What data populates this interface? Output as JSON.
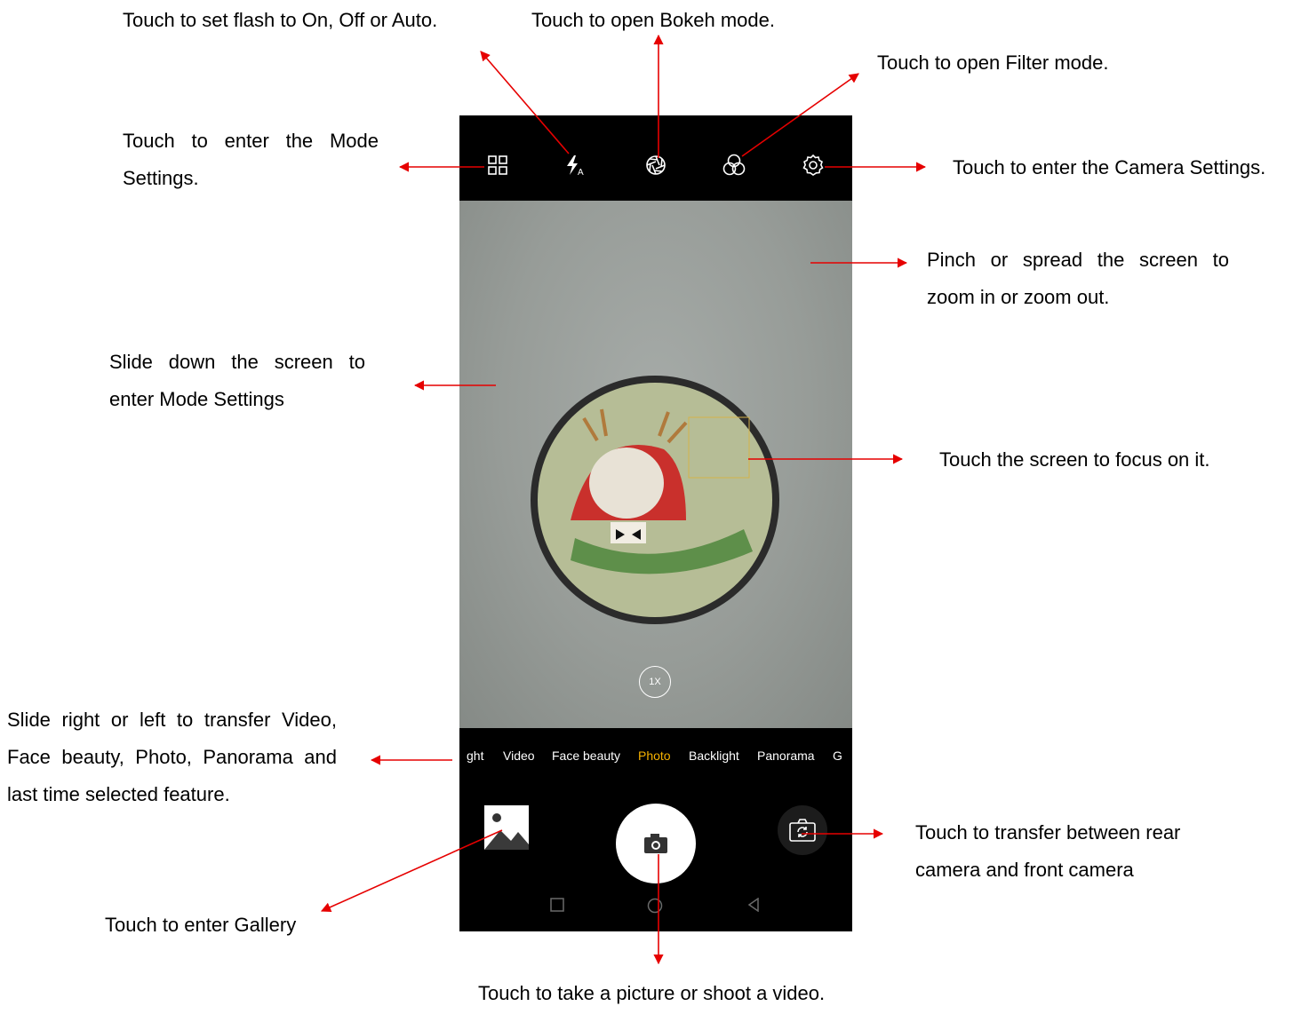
{
  "annotations": {
    "flash": "Touch to set flash to On, Off or Auto.",
    "bokeh": "Touch to open Bokeh mode.",
    "filter": "Touch to open Filter mode.",
    "mode_settings": "Touch to enter the Mode Settings.",
    "camera_settings": "Touch to enter the Camera Settings.",
    "zoom": "Pinch or spread the screen to zoom in or zoom out.",
    "slide_down": "Slide down the screen to enter Mode Settings",
    "focus": "Touch the screen to focus on it.",
    "slide_modes": "Slide right or left to transfer Video, Face beauty, Photo, Panorama and last time selected feature.",
    "switch_camera": "Touch to transfer between rear camera and front camera",
    "gallery": "Touch to enter Gallery",
    "shutter": "Touch to take a picture or shoot a video."
  },
  "camera": {
    "top_icons": [
      "mode-grid-icon",
      "flash-auto-icon",
      "bokeh-aperture-icon",
      "filter-icon",
      "settings-gear-icon"
    ],
    "zoom_level": "1X",
    "modes": [
      "ght",
      "Video",
      "Face beauty",
      "Photo",
      "Backlight",
      "Panorama",
      "G"
    ],
    "active_mode": "Photo"
  },
  "colors": {
    "arrow": "#e60000",
    "active_mode": "#f5b100",
    "phone_bg": "#000000"
  }
}
